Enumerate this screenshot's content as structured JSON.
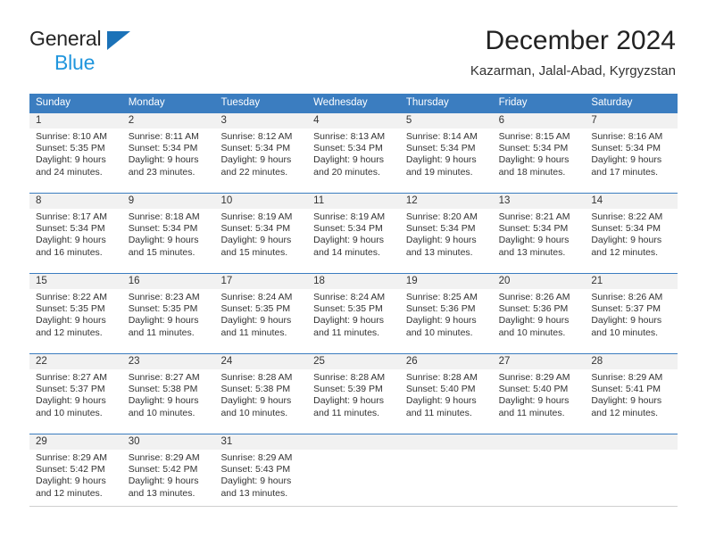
{
  "brand": {
    "name_part1": "General",
    "name_part2": "Blue",
    "triangle_icon": "blue-triangle-logo-mark",
    "color_dark": "#262626",
    "color_blue": "#2196dd"
  },
  "header": {
    "title": "December 2024",
    "subtitle": "Kazarman, Jalal-Abad, Kyrgyzstan"
  },
  "colors": {
    "header_row_background": "#3b7dc0",
    "header_row_text": "#ffffff",
    "daynum_band": "#f1f1f1",
    "cell_text": "#333333",
    "grid_line": "#3b7dc0"
  },
  "weekdays": [
    "Sunday",
    "Monday",
    "Tuesday",
    "Wednesday",
    "Thursday",
    "Friday",
    "Saturday"
  ],
  "weeks": [
    [
      {
        "day": "1",
        "sunrise": "Sunrise: 8:10 AM",
        "sunset": "Sunset: 5:35 PM",
        "daylight_line1": "Daylight: 9 hours",
        "daylight_line2": "and 24 minutes."
      },
      {
        "day": "2",
        "sunrise": "Sunrise: 8:11 AM",
        "sunset": "Sunset: 5:34 PM",
        "daylight_line1": "Daylight: 9 hours",
        "daylight_line2": "and 23 minutes."
      },
      {
        "day": "3",
        "sunrise": "Sunrise: 8:12 AM",
        "sunset": "Sunset: 5:34 PM",
        "daylight_line1": "Daylight: 9 hours",
        "daylight_line2": "and 22 minutes."
      },
      {
        "day": "4",
        "sunrise": "Sunrise: 8:13 AM",
        "sunset": "Sunset: 5:34 PM",
        "daylight_line1": "Daylight: 9 hours",
        "daylight_line2": "and 20 minutes."
      },
      {
        "day": "5",
        "sunrise": "Sunrise: 8:14 AM",
        "sunset": "Sunset: 5:34 PM",
        "daylight_line1": "Daylight: 9 hours",
        "daylight_line2": "and 19 minutes."
      },
      {
        "day": "6",
        "sunrise": "Sunrise: 8:15 AM",
        "sunset": "Sunset: 5:34 PM",
        "daylight_line1": "Daylight: 9 hours",
        "daylight_line2": "and 18 minutes."
      },
      {
        "day": "7",
        "sunrise": "Sunrise: 8:16 AM",
        "sunset": "Sunset: 5:34 PM",
        "daylight_line1": "Daylight: 9 hours",
        "daylight_line2": "and 17 minutes."
      }
    ],
    [
      {
        "day": "8",
        "sunrise": "Sunrise: 8:17 AM",
        "sunset": "Sunset: 5:34 PM",
        "daylight_line1": "Daylight: 9 hours",
        "daylight_line2": "and 16 minutes."
      },
      {
        "day": "9",
        "sunrise": "Sunrise: 8:18 AM",
        "sunset": "Sunset: 5:34 PM",
        "daylight_line1": "Daylight: 9 hours",
        "daylight_line2": "and 15 minutes."
      },
      {
        "day": "10",
        "sunrise": "Sunrise: 8:19 AM",
        "sunset": "Sunset: 5:34 PM",
        "daylight_line1": "Daylight: 9 hours",
        "daylight_line2": "and 15 minutes."
      },
      {
        "day": "11",
        "sunrise": "Sunrise: 8:19 AM",
        "sunset": "Sunset: 5:34 PM",
        "daylight_line1": "Daylight: 9 hours",
        "daylight_line2": "and 14 minutes."
      },
      {
        "day": "12",
        "sunrise": "Sunrise: 8:20 AM",
        "sunset": "Sunset: 5:34 PM",
        "daylight_line1": "Daylight: 9 hours",
        "daylight_line2": "and 13 minutes."
      },
      {
        "day": "13",
        "sunrise": "Sunrise: 8:21 AM",
        "sunset": "Sunset: 5:34 PM",
        "daylight_line1": "Daylight: 9 hours",
        "daylight_line2": "and 13 minutes."
      },
      {
        "day": "14",
        "sunrise": "Sunrise: 8:22 AM",
        "sunset": "Sunset: 5:34 PM",
        "daylight_line1": "Daylight: 9 hours",
        "daylight_line2": "and 12 minutes."
      }
    ],
    [
      {
        "day": "15",
        "sunrise": "Sunrise: 8:22 AM",
        "sunset": "Sunset: 5:35 PM",
        "daylight_line1": "Daylight: 9 hours",
        "daylight_line2": "and 12 minutes."
      },
      {
        "day": "16",
        "sunrise": "Sunrise: 8:23 AM",
        "sunset": "Sunset: 5:35 PM",
        "daylight_line1": "Daylight: 9 hours",
        "daylight_line2": "and 11 minutes."
      },
      {
        "day": "17",
        "sunrise": "Sunrise: 8:24 AM",
        "sunset": "Sunset: 5:35 PM",
        "daylight_line1": "Daylight: 9 hours",
        "daylight_line2": "and 11 minutes."
      },
      {
        "day": "18",
        "sunrise": "Sunrise: 8:24 AM",
        "sunset": "Sunset: 5:35 PM",
        "daylight_line1": "Daylight: 9 hours",
        "daylight_line2": "and 11 minutes."
      },
      {
        "day": "19",
        "sunrise": "Sunrise: 8:25 AM",
        "sunset": "Sunset: 5:36 PM",
        "daylight_line1": "Daylight: 9 hours",
        "daylight_line2": "and 10 minutes."
      },
      {
        "day": "20",
        "sunrise": "Sunrise: 8:26 AM",
        "sunset": "Sunset: 5:36 PM",
        "daylight_line1": "Daylight: 9 hours",
        "daylight_line2": "and 10 minutes."
      },
      {
        "day": "21",
        "sunrise": "Sunrise: 8:26 AM",
        "sunset": "Sunset: 5:37 PM",
        "daylight_line1": "Daylight: 9 hours",
        "daylight_line2": "and 10 minutes."
      }
    ],
    [
      {
        "day": "22",
        "sunrise": "Sunrise: 8:27 AM",
        "sunset": "Sunset: 5:37 PM",
        "daylight_line1": "Daylight: 9 hours",
        "daylight_line2": "and 10 minutes."
      },
      {
        "day": "23",
        "sunrise": "Sunrise: 8:27 AM",
        "sunset": "Sunset: 5:38 PM",
        "daylight_line1": "Daylight: 9 hours",
        "daylight_line2": "and 10 minutes."
      },
      {
        "day": "24",
        "sunrise": "Sunrise: 8:28 AM",
        "sunset": "Sunset: 5:38 PM",
        "daylight_line1": "Daylight: 9 hours",
        "daylight_line2": "and 10 minutes."
      },
      {
        "day": "25",
        "sunrise": "Sunrise: 8:28 AM",
        "sunset": "Sunset: 5:39 PM",
        "daylight_line1": "Daylight: 9 hours",
        "daylight_line2": "and 11 minutes."
      },
      {
        "day": "26",
        "sunrise": "Sunrise: 8:28 AM",
        "sunset": "Sunset: 5:40 PM",
        "daylight_line1": "Daylight: 9 hours",
        "daylight_line2": "and 11 minutes."
      },
      {
        "day": "27",
        "sunrise": "Sunrise: 8:29 AM",
        "sunset": "Sunset: 5:40 PM",
        "daylight_line1": "Daylight: 9 hours",
        "daylight_line2": "and 11 minutes."
      },
      {
        "day": "28",
        "sunrise": "Sunrise: 8:29 AM",
        "sunset": "Sunset: 5:41 PM",
        "daylight_line1": "Daylight: 9 hours",
        "daylight_line2": "and 12 minutes."
      }
    ],
    [
      {
        "day": "29",
        "sunrise": "Sunrise: 8:29 AM",
        "sunset": "Sunset: 5:42 PM",
        "daylight_line1": "Daylight: 9 hours",
        "daylight_line2": "and 12 minutes."
      },
      {
        "day": "30",
        "sunrise": "Sunrise: 8:29 AM",
        "sunset": "Sunset: 5:42 PM",
        "daylight_line1": "Daylight: 9 hours",
        "daylight_line2": "and 13 minutes."
      },
      {
        "day": "31",
        "sunrise": "Sunrise: 8:29 AM",
        "sunset": "Sunset: 5:43 PM",
        "daylight_line1": "Daylight: 9 hours",
        "daylight_line2": "and 13 minutes."
      },
      {
        "day": "",
        "sunrise": "",
        "sunset": "",
        "daylight_line1": "",
        "daylight_line2": ""
      },
      {
        "day": "",
        "sunrise": "",
        "sunset": "",
        "daylight_line1": "",
        "daylight_line2": ""
      },
      {
        "day": "",
        "sunrise": "",
        "sunset": "",
        "daylight_line1": "",
        "daylight_line2": ""
      },
      {
        "day": "",
        "sunrise": "",
        "sunset": "",
        "daylight_line1": "",
        "daylight_line2": ""
      }
    ]
  ]
}
